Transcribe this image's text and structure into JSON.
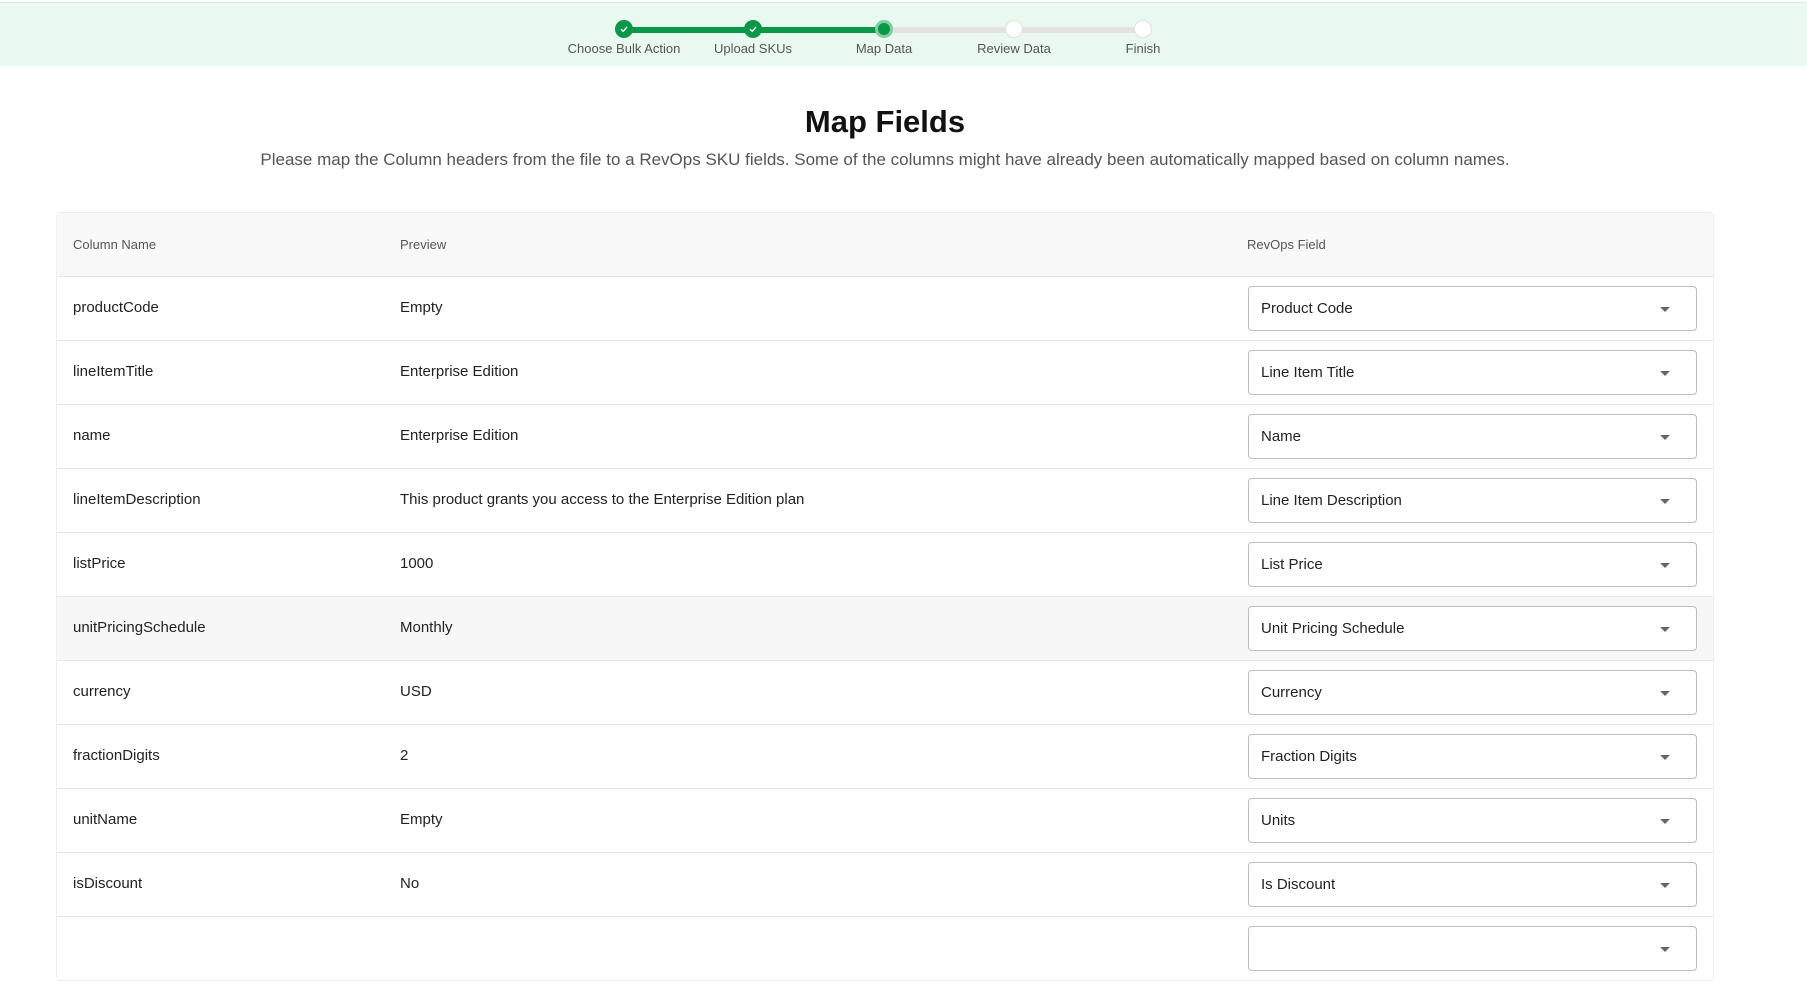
{
  "stepper": {
    "steps": [
      {
        "label": "Choose Bulk Action",
        "status": "done"
      },
      {
        "label": "Upload SKUs",
        "status": "done"
      },
      {
        "label": "Map Data",
        "status": "current"
      },
      {
        "label": "Review Data",
        "status": "todo"
      },
      {
        "label": "Finish",
        "status": "todo"
      }
    ],
    "accent_color": "#0a9747"
  },
  "page": {
    "title": "Map Fields",
    "subtitle": "Please map the Column headers from the file to a RevOps SKU fields. Some of the columns might have already been automatically mapped based on column names."
  },
  "table": {
    "headers": {
      "column_name": "Column Name",
      "preview": "Preview",
      "revops_field": "RevOps Field"
    },
    "rows": [
      {
        "column": "productCode",
        "preview": "Empty",
        "field": "Product Code"
      },
      {
        "column": "lineItemTitle",
        "preview": "Enterprise Edition",
        "field": "Line Item Title"
      },
      {
        "column": "name",
        "preview": "Enterprise Edition",
        "field": "Name"
      },
      {
        "column": "lineItemDescription",
        "preview": "This product grants you access to the Enterprise Edition plan",
        "field": "Line Item Description"
      },
      {
        "column": "listPrice",
        "preview": "1000",
        "field": "List Price"
      },
      {
        "column": "unitPricingSchedule",
        "preview": "Monthly",
        "field": "Unit Pricing Schedule"
      },
      {
        "column": "currency",
        "preview": "USD",
        "field": "Currency"
      },
      {
        "column": "fractionDigits",
        "preview": "2",
        "field": "Fraction Digits"
      },
      {
        "column": "unitName",
        "preview": "Empty",
        "field": "Units"
      },
      {
        "column": "isDiscount",
        "preview": "No",
        "field": "Is Discount"
      }
    ]
  }
}
